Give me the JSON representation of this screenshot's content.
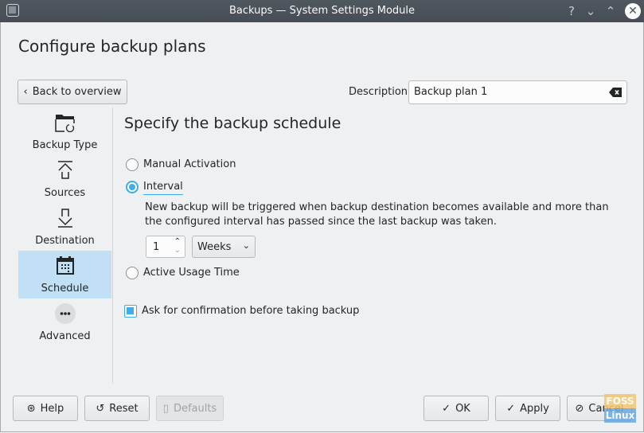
{
  "window": {
    "title": "Backups — System Settings Module",
    "controls": {
      "help": "?",
      "minimize": "⌄",
      "maximize": "⌃",
      "close": "✕"
    }
  },
  "header": {
    "page_title": "Configure backup plans",
    "back_button": "Back to overview",
    "description_label": "Description:",
    "description_value": "Backup plan 1"
  },
  "sidebar": {
    "items": [
      {
        "label": "Backup Type",
        "icon": "folder-icon",
        "selected": false
      },
      {
        "label": "Sources",
        "icon": "upload-icon",
        "selected": false
      },
      {
        "label": "Destination",
        "icon": "download-icon",
        "selected": false
      },
      {
        "label": "Schedule",
        "icon": "calendar-icon",
        "selected": true
      },
      {
        "label": "Advanced",
        "icon": "more-icon",
        "selected": false
      }
    ]
  },
  "schedule": {
    "title": "Specify the backup schedule",
    "options": [
      {
        "label": "Manual Activation",
        "checked": false
      },
      {
        "label": "Interval",
        "checked": true
      },
      {
        "label": "Active Usage Time",
        "checked": false
      }
    ],
    "interval_description": "New backup will be triggered when backup destination becomes available and more than the configured interval has passed since the last backup was taken.",
    "interval_value": "1",
    "interval_unit": "Weeks",
    "confirm_label": "Ask for confirmation before taking backup",
    "confirm_checked": true
  },
  "footer": {
    "help": "Help",
    "reset": "Reset",
    "defaults": "Defaults",
    "ok": "OK",
    "apply": "Apply",
    "cancel": "Cancel"
  },
  "watermark": {
    "line1": "FOSS",
    "line2": "Linux"
  },
  "colors": {
    "accent": "#3daee9",
    "selection": "#c2e0f5",
    "titlebar": "#4b535b"
  }
}
